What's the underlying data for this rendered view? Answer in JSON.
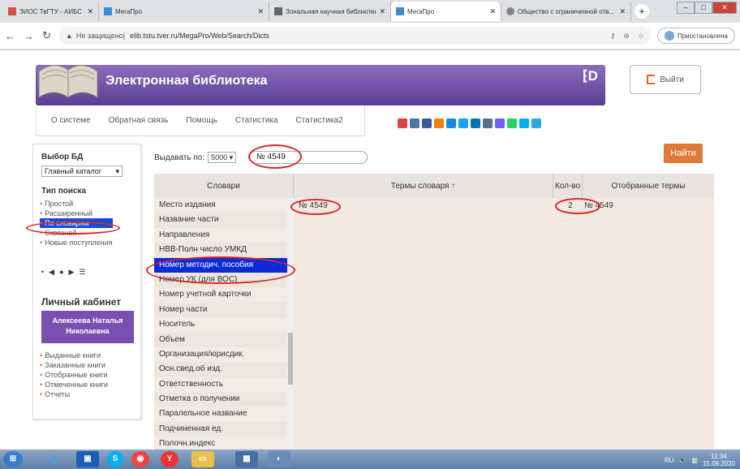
{
  "browser": {
    "tabs": [
      {
        "title": "ЗИОС ТвГТУ - АИБС МегаПро",
        "active": false
      },
      {
        "title": "МегаПро",
        "active": false
      },
      {
        "title": "Зональная научная библиотека",
        "active": false
      },
      {
        "title": "МегаПро",
        "active": true
      },
      {
        "title": "Общество с ограниченной отв...",
        "active": false
      }
    ],
    "security_label": "Не защищено",
    "url": "elib.tstu.tver.ru/MegaPro/Web/Search/Dicts",
    "profile_label": "Приостановлена"
  },
  "header": {
    "title": "Электронная библиотека",
    "logout_label": "Выйти"
  },
  "topnav": [
    "О системе",
    "Обратная связь",
    "Помощь",
    "Статистика",
    "Статистика2"
  ],
  "sidebar": {
    "db_heading": "Выбор БД",
    "db_value": "Главный каталог",
    "search_type_heading": "Тип поиска",
    "search_types": [
      "Простой",
      "Расширенный",
      "По словарям",
      "Сквозной",
      "Новые поступления"
    ],
    "active_search_type": "По словарям",
    "cabinet_heading": "Личный кабинет",
    "user_name": "Алексеева Наталья Николаевна",
    "cabinet_links": [
      "Выданные книги",
      "Заказанные книги",
      "Отобранные книги",
      "Отмеченные книги",
      "Отчеты"
    ]
  },
  "search": {
    "issue_label": "Выдавать по:",
    "issue_value": "5000",
    "query": "№ 4549",
    "find_label": "Найти"
  },
  "grid": {
    "headers": {
      "dicts": "Словари",
      "terms": "Термы словаря ↑",
      "count": "Кол-во",
      "selected": "Отобранные термы"
    },
    "dicts": [
      "Место издания",
      "Название части",
      "Направления",
      "НВВ-Полн число УМКД",
      "Номер методич. пособия",
      "Номер УК (для ВОС)",
      "Номер учетной карточки",
      "Номер части",
      "Носитель",
      "Объем",
      "Организация/юрисдик.",
      "Осн.свед.об изд.",
      "Ответственность",
      "Отметка о получении",
      "Паралельное название",
      "Подчиненная ед.",
      "Полочн.индекс"
    ],
    "selected_dict": "Номер методич. пособия",
    "term": "№ 4549",
    "count": "2",
    "selected_term": "№ 4549"
  },
  "colors": {
    "banner": "#6b4fa8",
    "accent": "#e07a3a",
    "selection": "#0a2bd6",
    "annotation": "#d42a2a"
  },
  "taskbar": {
    "lang": "RU",
    "time": "11:34",
    "date": "15.09.2020"
  }
}
